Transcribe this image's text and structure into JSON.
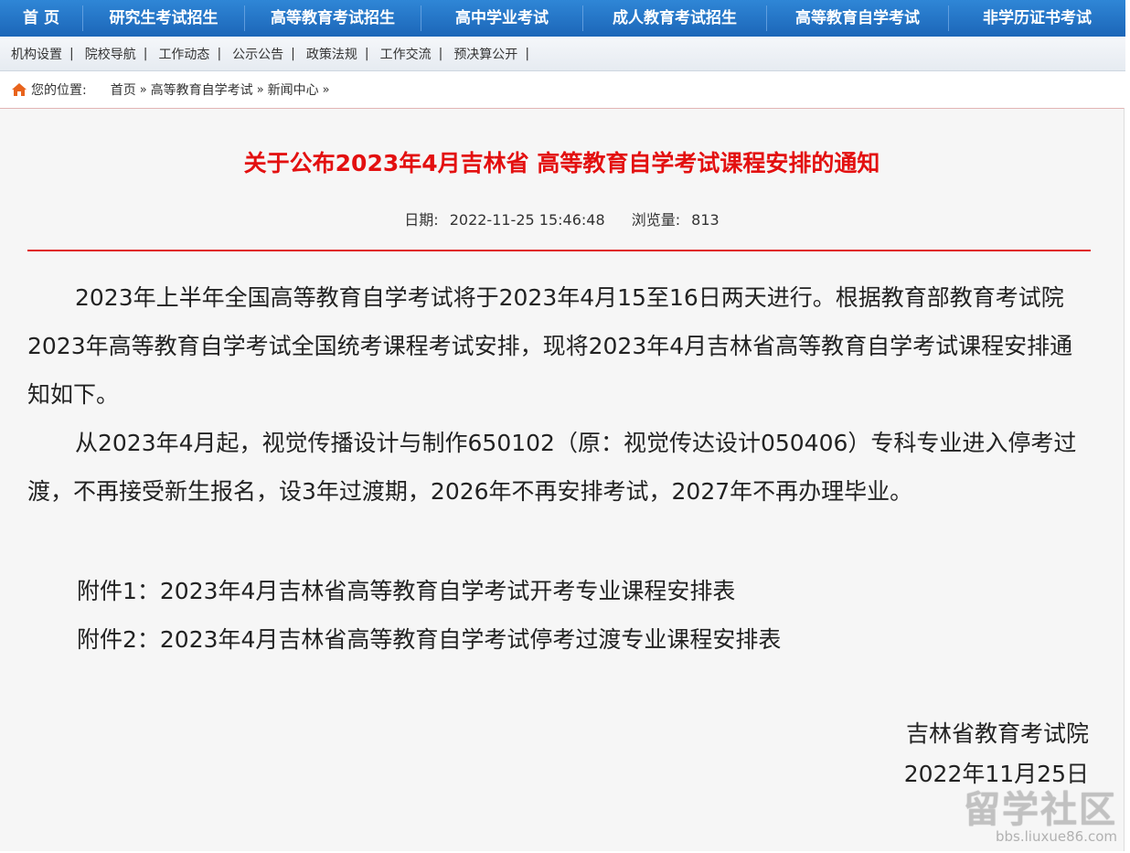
{
  "topnav": [
    {
      "label": "首 页"
    },
    {
      "label": "研究生考试招生"
    },
    {
      "label": "高等教育考试招生"
    },
    {
      "label": "高中学业考试"
    },
    {
      "label": "成人教育考试招生"
    },
    {
      "label": "高等教育自学考试"
    },
    {
      "label": "非学历证书考试"
    }
  ],
  "subnav": [
    {
      "label": "机构设置"
    },
    {
      "label": "院校导航"
    },
    {
      "label": "工作动态"
    },
    {
      "label": "公示公告"
    },
    {
      "label": "政策法规"
    },
    {
      "label": "工作交流"
    },
    {
      "label": "预决算公开"
    }
  ],
  "breadcrumb": {
    "prefix": "您的位置:",
    "items": [
      {
        "label": "首页"
      },
      {
        "label": "高等教育自学考试"
      },
      {
        "label": "新闻中心"
      }
    ],
    "separator": "»"
  },
  "article": {
    "title": "关于公布2023年4月吉林省 高等教育自学考试课程安排的通知",
    "date_label": "日期:",
    "date": "2022-11-25 15:46:48",
    "views_label": "浏览量:",
    "views": "813",
    "paragraphs": [
      "2023年上半年全国高等教育自学考试将于2023年4月15至16日两天进行。根据教育部教育考试院2023年高等教育自学考试全国统考课程考试安排，现将2023年4月吉林省高等教育自学考试课程安排通知如下。",
      "从2023年4月起，视觉传播设计与制作650102（原：视觉传达设计050406）专科专业进入停考过渡，不再接受新生报名，设3年过渡期，2026年不再安排考试，2027年不再办理毕业。"
    ],
    "attachments": [
      {
        "label": "附件1：2023年4月吉林省高等教育自学考试开考专业课程安排表"
      },
      {
        "label": "附件2：2023年4月吉林省高等教育自学考试停考过渡专业课程安排表"
      }
    ],
    "signature": "吉林省教育考试院",
    "signature_date": "2022年11月25日"
  },
  "watermark": {
    "big": "留学社区",
    "small": "bbs.liuxue86.com"
  },
  "colors": {
    "nav_blue": "#1c66b8",
    "title_red": "#e31010",
    "rule_red": "#e01f1f",
    "home_icon": "#e8631c"
  }
}
